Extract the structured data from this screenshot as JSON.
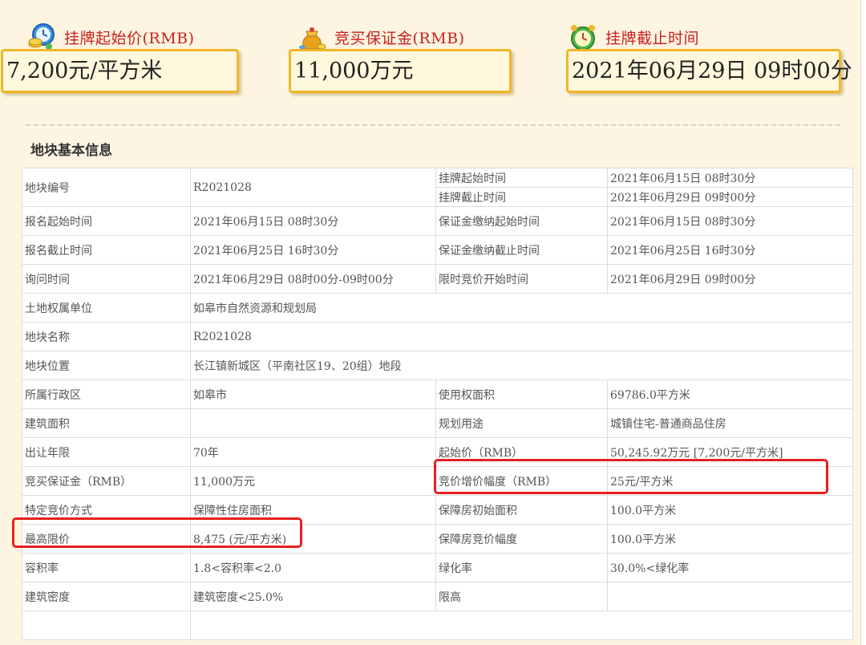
{
  "summary": {
    "start_price": {
      "title": "挂牌起始价(RMB)",
      "value": "7,200元/平方米",
      "icon": "clock-coins-icon"
    },
    "deposit": {
      "title": "竞买保证金(RMB)",
      "value": "11,000万元",
      "icon": "money-bag-icon"
    },
    "deadline": {
      "title": "挂牌截止时间",
      "value": "2021年06月29日 09时00分",
      "icon": "alarm-clock-icon"
    }
  },
  "section_title": "地块基本信息",
  "table": {
    "r1": {
      "label": "地块编号",
      "value": "R2021028",
      "label3a": "挂牌起始时间",
      "value3a": "2021年06月15日 08时30分",
      "label3b": "挂牌截止时间",
      "value3b": "2021年06月29日 09时00分"
    },
    "r2": {
      "c1": "报名起始时间",
      "c2": "2021年06月15日 08时30分",
      "c3": "保证金缴纳起始时间",
      "c4": "2021年06月15日 08时30分"
    },
    "r3": {
      "c1": "报名截止时间",
      "c2": "2021年06月25日 16时30分",
      "c3": "保证金缴纳截止时间",
      "c4": "2021年06月25日 16时30分"
    },
    "r4": {
      "c1": "询问时间",
      "c2": "2021年06月29日 08时00分-09时00分",
      "c3": "限时竞价开始时间",
      "c4": "2021年06月29日 09时00分"
    },
    "r5": {
      "c1": "土地权属单位",
      "c2": "如皋市自然资源和规划局"
    },
    "r6": {
      "c1": "地块名称",
      "c2": "R2021028"
    },
    "r7": {
      "c1": "地块位置",
      "c2": "长江镇新城区（平南社区19、20组）地段"
    },
    "r8": {
      "c1": "所属行政区",
      "c2": "如皋市",
      "c3": "使用权面积",
      "c4": "69786.0平方米"
    },
    "r9": {
      "c1": "建筑面积",
      "c2": "",
      "c3": "规划用途",
      "c4": "城镇住宅-普通商品住房"
    },
    "r10": {
      "c1": "出让年限",
      "c2": "70年",
      "c3": "起始价（RMB）",
      "c4": "50,245.92万元 [7,200元/平方米]"
    },
    "r11": {
      "c1": "竞买保证金（RMB）",
      "c2": "11,000万元",
      "c3": "竞价增价幅度（RMB）",
      "c4": "25元/平方米"
    },
    "r12": {
      "c1": "特定竞价方式",
      "c2": "保障性住房面积",
      "c3": "保障房初始面积",
      "c4": "100.0平方米"
    },
    "r13": {
      "c1": "最高限价",
      "c2": "8,475 (元/平方米)",
      "c3": "保障房竞价幅度",
      "c4": "100.0平方米"
    },
    "r14": {
      "c1": "容积率",
      "c2": "1.8<容积率<2.0",
      "c3": "绿化率",
      "c4": "30.0%<绿化率"
    },
    "r15": {
      "c1": "建筑密度",
      "c2": "建筑密度<25.0%",
      "c3": "限高",
      "c4": ""
    }
  },
  "colors": {
    "accent_red": "#cc1e1e",
    "card_border": "#f0b628",
    "highlight": "#e62020",
    "page_bg": "#fdf5e1"
  }
}
